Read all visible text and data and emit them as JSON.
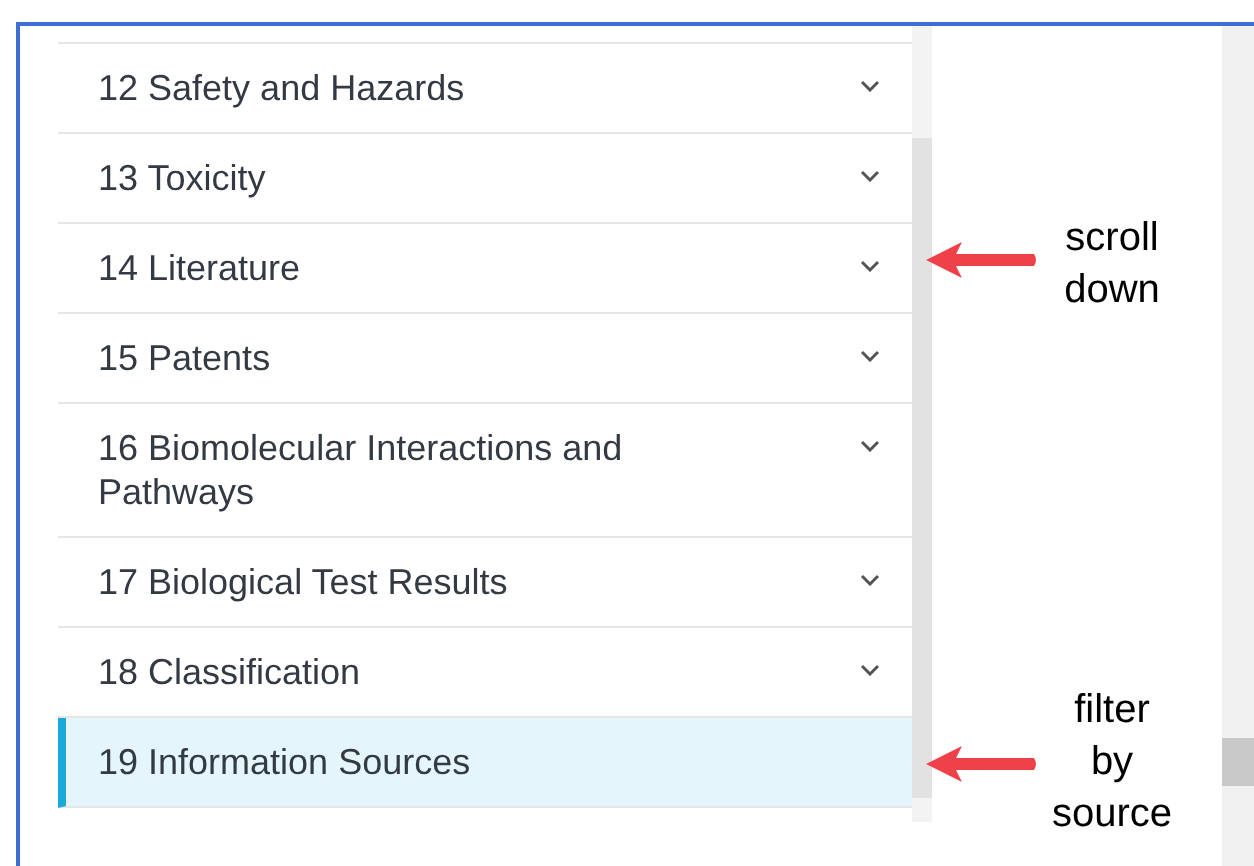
{
  "sections": [
    {
      "label": "12 Safety and Hazards",
      "expandable": true,
      "selected": false
    },
    {
      "label": "13 Toxicity",
      "expandable": true,
      "selected": false
    },
    {
      "label": "14 Literature",
      "expandable": true,
      "selected": false
    },
    {
      "label": "15 Patents",
      "expandable": true,
      "selected": false
    },
    {
      "label": "16 Biomolecular Interactions and Pathways",
      "expandable": true,
      "selected": false
    },
    {
      "label": "17 Biological Test Results",
      "expandable": true,
      "selected": false
    },
    {
      "label": "18 Classification",
      "expandable": true,
      "selected": false
    },
    {
      "label": "19 Information Sources",
      "expandable": false,
      "selected": true
    }
  ],
  "annotations": [
    {
      "text": "scroll down"
    },
    {
      "text": "filter by source"
    }
  ]
}
